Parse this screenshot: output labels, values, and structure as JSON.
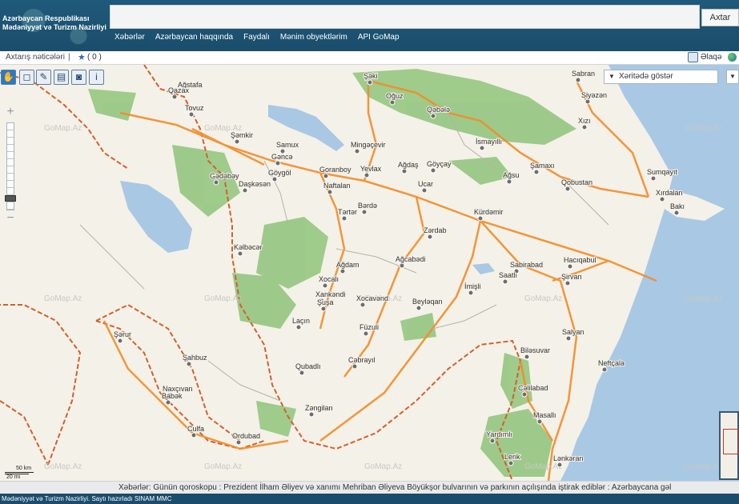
{
  "header": {
    "brand_line1": "Azərbaycan Respublikası",
    "brand_line2": "Mədəniyyət və Turizm Nazirliyi",
    "search_placeholder": "",
    "search_button": "Axtar"
  },
  "nav": [
    "Xəbərlər",
    "Azərbaycan haqqında",
    "Faydalı",
    "Mənim obyektlərim",
    "API GoMap"
  ],
  "subbar": {
    "results_label": "Axtarış nəticələri",
    "separator": "|",
    "favorites_count": "( 0 )",
    "contact_label": "Əlaqə"
  },
  "map": {
    "show_on_map_label": "Xəritədə göstər",
    "watermark": "GoMap.Az",
    "scale_km": "50 km",
    "scale_mi": "20 mi",
    "colors": {
      "land": "#f4f1e8",
      "water": "#a9c8e4",
      "forest": "#8fc47a",
      "road": "#f28c28",
      "border": "#d2602c"
    },
    "cities": [
      {
        "name": "Şəki"
      },
      {
        "name": "Sabran"
      },
      {
        "name": "Siyəzən"
      },
      {
        "name": "Oğuz"
      },
      {
        "name": "Qəbələ"
      },
      {
        "name": "Xızı"
      },
      {
        "name": "Ağstafa"
      },
      {
        "name": "Qazax"
      },
      {
        "name": "Tovuz"
      },
      {
        "name": "İsmayıllı"
      },
      {
        "name": "Şəmkir"
      },
      {
        "name": "Samux"
      },
      {
        "name": "Mingəçevir"
      },
      {
        "name": "Gəncə"
      },
      {
        "name": "Ağdaş"
      },
      {
        "name": "Göyçay"
      },
      {
        "name": "Şamaxı"
      },
      {
        "name": "Sumqayıt"
      },
      {
        "name": "Gədəbəy"
      },
      {
        "name": "Goranboy"
      },
      {
        "name": "Yevlax"
      },
      {
        "name": "Göygöl"
      },
      {
        "name": "Daşkəsən"
      },
      {
        "name": "Ağsu"
      },
      {
        "name": "Qobustan"
      },
      {
        "name": "Xırdalan"
      },
      {
        "name": "Naftalan"
      },
      {
        "name": "Ucar"
      },
      {
        "name": "Bakı"
      },
      {
        "name": "Bərdə"
      },
      {
        "name": "Tərtər"
      },
      {
        "name": "Kürdəmir"
      },
      {
        "name": "Zərdab"
      },
      {
        "name": "Kəlbəcər"
      },
      {
        "name": "Ağcabədi"
      },
      {
        "name": "Hacıqabul"
      },
      {
        "name": "Ağdam"
      },
      {
        "name": "Sabirabad"
      },
      {
        "name": "Saatlı"
      },
      {
        "name": "Şirvan"
      },
      {
        "name": "Xocalı"
      },
      {
        "name": "İmişli"
      },
      {
        "name": "Xankəndi"
      },
      {
        "name": "Şuşa"
      },
      {
        "name": "Xocavənd"
      },
      {
        "name": "Beyləqan"
      },
      {
        "name": "Laçın"
      },
      {
        "name": "Füzuli"
      },
      {
        "name": "Salyan"
      },
      {
        "name": "Şərur"
      },
      {
        "name": "Biləsuvar"
      },
      {
        "name": "Şahbuz"
      },
      {
        "name": "Cəbrayıl"
      },
      {
        "name": "Neftçala"
      },
      {
        "name": "Qubadlı"
      },
      {
        "name": "Naxçıvan"
      },
      {
        "name": "Babək"
      },
      {
        "name": "Cəlilabad"
      },
      {
        "name": "Zəngilan"
      },
      {
        "name": "Masallı"
      },
      {
        "name": "Culfa"
      },
      {
        "name": "Ordubad"
      },
      {
        "name": "Yardımlı"
      },
      {
        "name": "Lerik"
      },
      {
        "name": "Lənkəran"
      }
    ]
  },
  "ticker": {
    "text": "Xəbərlər:   Günün qoroskopu   :   Prezident İlham Əliyev və xanımı Mehriban Əliyeva Böyükşor bulvarının və parkının açılışında iştirak ediblər   :   Azərbaycana gəl"
  },
  "footer": {
    "text": "Mədəniyyət və Turizm Nazirliyi. Saytı hazırladı SINAM MMC"
  }
}
